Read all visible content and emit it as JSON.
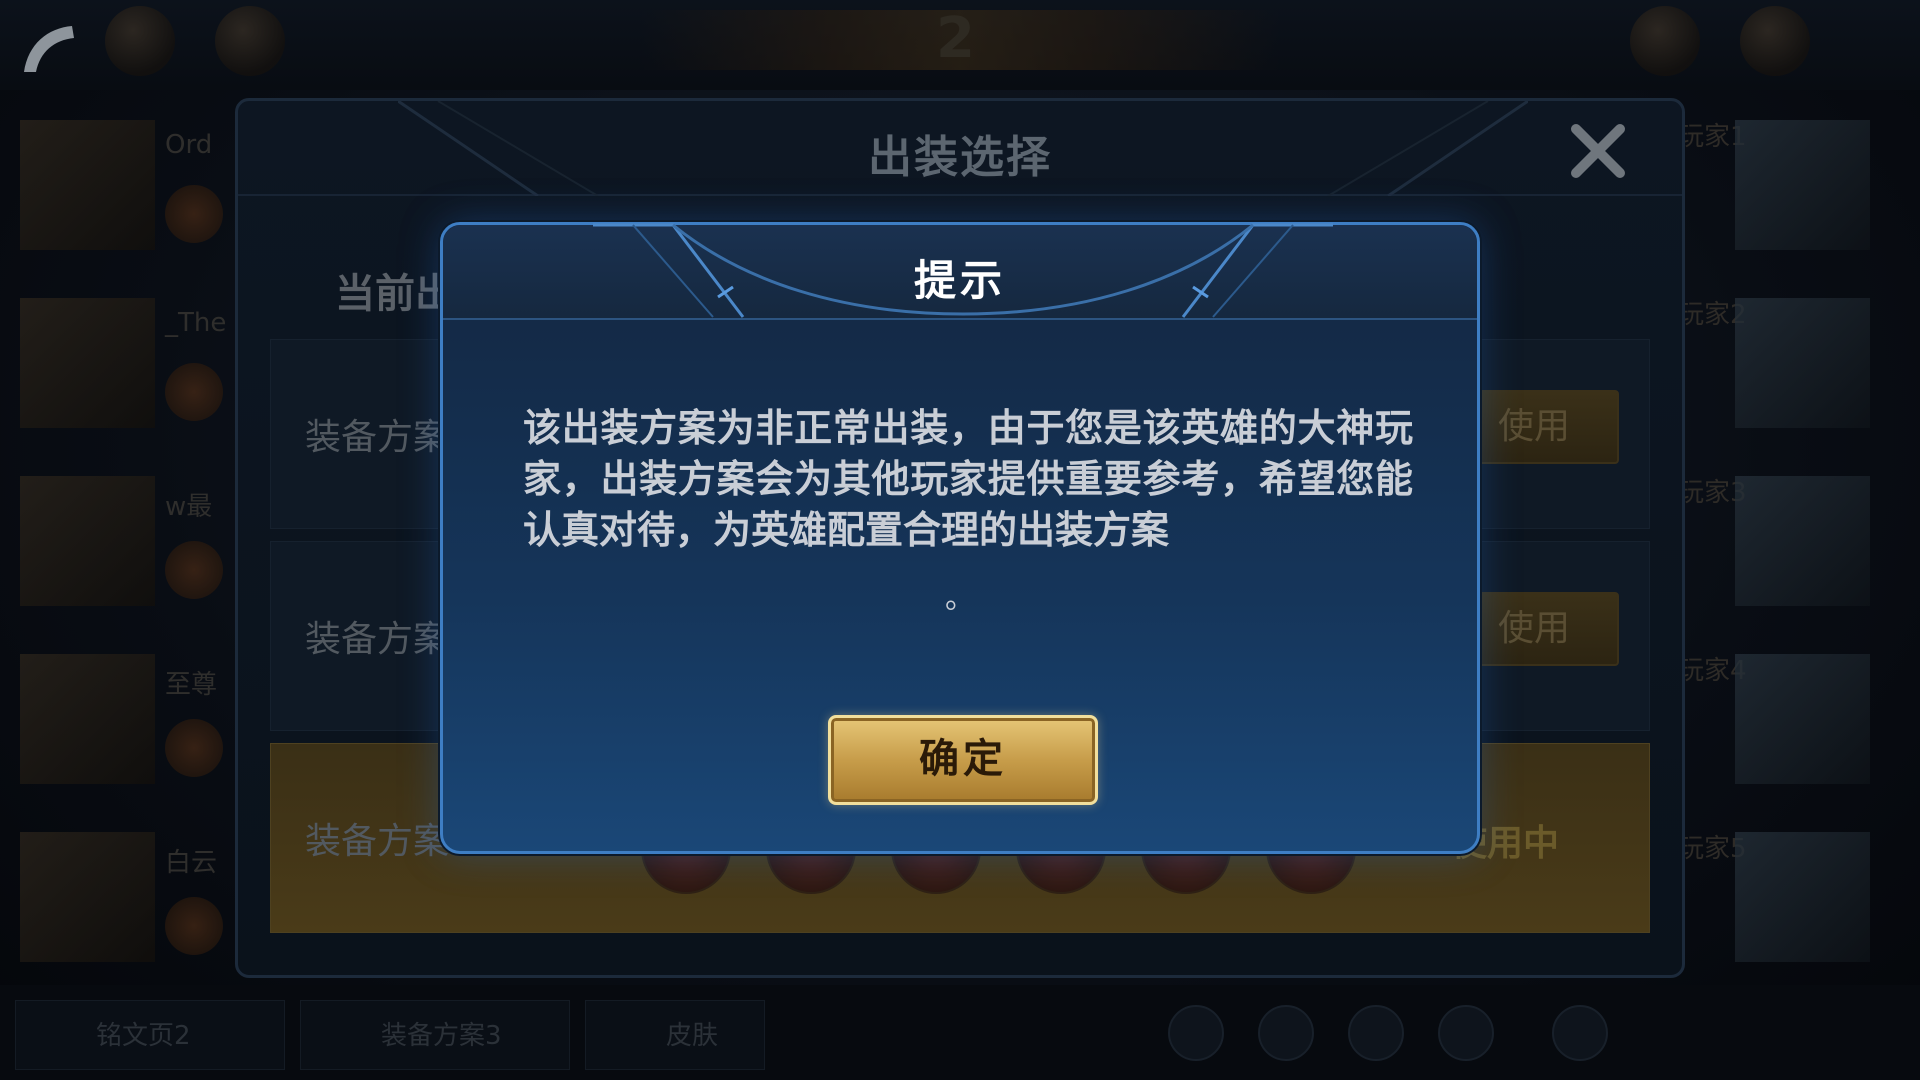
{
  "top_bar": {
    "center_number": "2"
  },
  "left_players": [
    {
      "name": "Ord"
    },
    {
      "name": "_The"
    },
    {
      "name": "w最"
    },
    {
      "name": "至尊"
    },
    {
      "name": "白云"
    }
  ],
  "right_players": [
    {
      "label": "玩家1"
    },
    {
      "label": "玩家2"
    },
    {
      "label": "玩家3"
    },
    {
      "label": "玩家4"
    },
    {
      "label": "玩家5"
    }
  ],
  "bottom_bar": {
    "items": [
      {
        "label": "铭文页2"
      },
      {
        "label": "装备方案3"
      },
      {
        "label": "皮肤"
      }
    ]
  },
  "panel": {
    "title": "出装选择",
    "subtitle": "当前出",
    "rows": [
      {
        "label": "装备方案",
        "action": "使用"
      },
      {
        "label": "装备方案",
        "action": "使用"
      },
      {
        "label": "装备方案",
        "action": "使用中"
      }
    ]
  },
  "dialog": {
    "title": "提示",
    "message": "该出装方案为非正常出装，由于您是该英雄的大神玩家，出装方案会为其他玩家提供重要参考，希望您能认真对待，为英雄配置合理的出装方案",
    "message_tail": "。",
    "confirm_label": "确定"
  },
  "colors": {
    "dialog_border": "#3e7ec4",
    "button_gold": "#c79d4a",
    "active_row": "#4a3b18"
  }
}
